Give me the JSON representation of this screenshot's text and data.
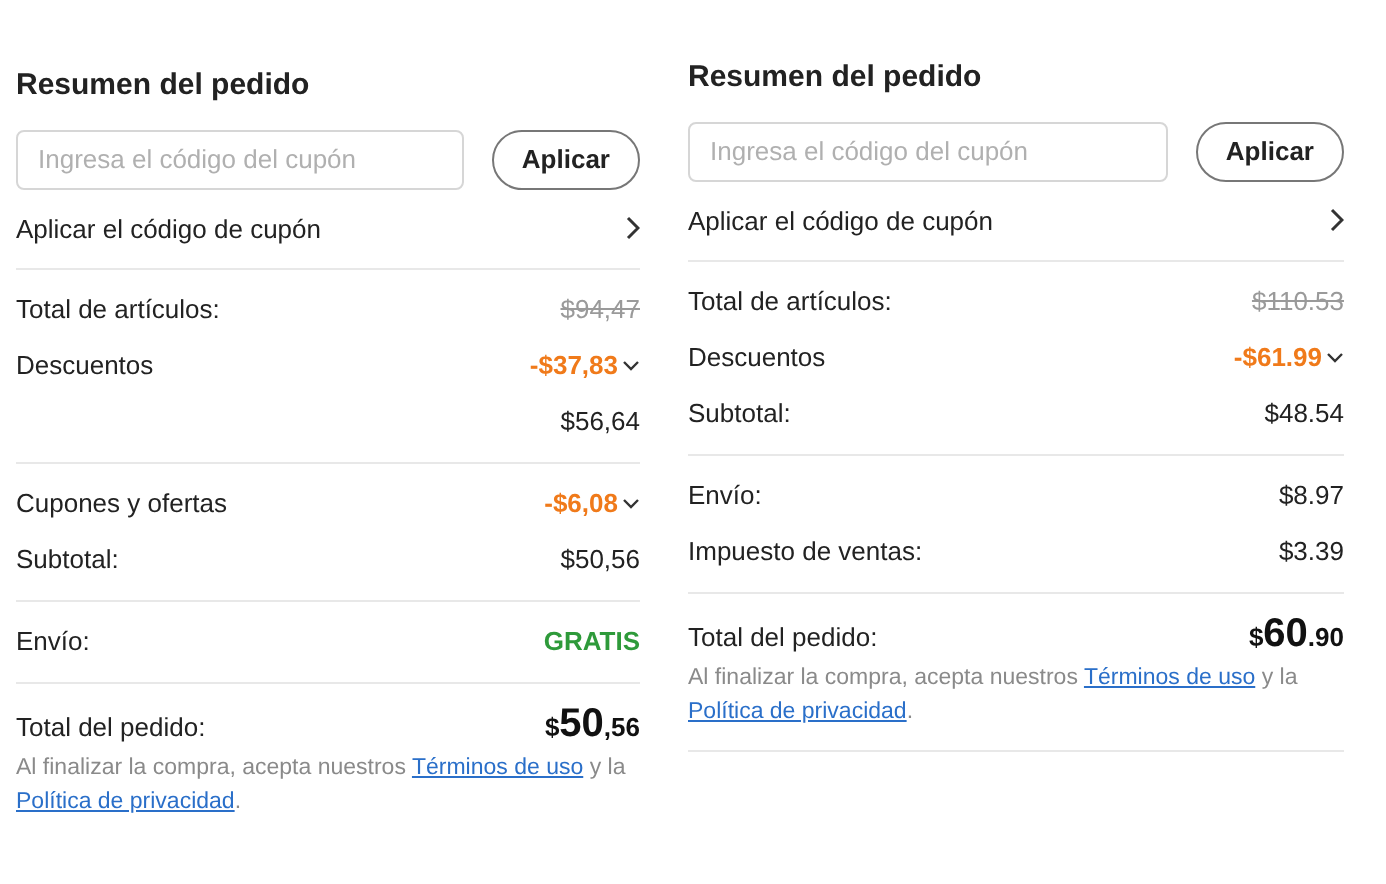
{
  "panels": [
    {
      "title": "Resumen del pedido",
      "coupon": {
        "placeholder": "Ingresa el código del cupón",
        "button": "Aplicar"
      },
      "coupon_link": "Aplicar el código de cupón",
      "sections": [
        {
          "rows": [
            {
              "label": "Total de artículos:",
              "value": "$94,47",
              "kind": "strike",
              "expandable": false
            },
            {
              "label": "Descuentos",
              "value": "-$37,83",
              "kind": "discount",
              "expandable": true
            },
            {
              "value": "$56,64",
              "kind": "plain",
              "expandable": false
            }
          ]
        },
        {
          "rows": [
            {
              "label": "Cupones y ofertas",
              "value": "-$6,08",
              "kind": "discount",
              "expandable": true
            },
            {
              "label": "Subtotal:",
              "value": "$50,56",
              "kind": "plain",
              "expandable": false
            }
          ]
        },
        {
          "rows": [
            {
              "label": "Envío:",
              "value": "GRATIS",
              "kind": "free",
              "expandable": false
            }
          ]
        }
      ],
      "total": {
        "label": "Total del pedido:",
        "currency": "$",
        "whole": "50",
        "cents": ",56"
      },
      "legal": {
        "before": "Al finalizar la compra, acepta nuestros",
        "terms": "Términos de uso",
        "middle": "y la",
        "privacy": "Política de privacidad",
        "after": "."
      },
      "closing_rule": false
    },
    {
      "title": "Resumen del pedido",
      "coupon": {
        "placeholder": "Ingresa el código del cupón",
        "button": "Aplicar"
      },
      "coupon_link": "Aplicar el código de cupón",
      "sections": [
        {
          "rows": [
            {
              "label": "Total de artículos:",
              "value": "$110.53",
              "kind": "strike",
              "expandable": false
            },
            {
              "label": "Descuentos",
              "value": "-$61.99",
              "kind": "discount",
              "expandable": true
            },
            {
              "label": "Subtotal:",
              "value": "$48.54",
              "kind": "plain",
              "expandable": false
            }
          ]
        },
        {
          "rows": [
            {
              "label": "Envío:",
              "value": "$8.97",
              "kind": "plain",
              "expandable": false
            },
            {
              "label": "Impuesto de ventas:",
              "value": "$3.39",
              "kind": "plain",
              "expandable": false
            }
          ]
        }
      ],
      "total": {
        "label": "Total del pedido:",
        "currency": "$",
        "whole": "60",
        "cents": ".90"
      },
      "legal": {
        "before": "Al finalizar la compra, acepta nuestros",
        "terms": "Términos de uso",
        "middle": "y la",
        "privacy": "Política de privacidad",
        "after": "."
      },
      "closing_rule": true
    }
  ]
}
